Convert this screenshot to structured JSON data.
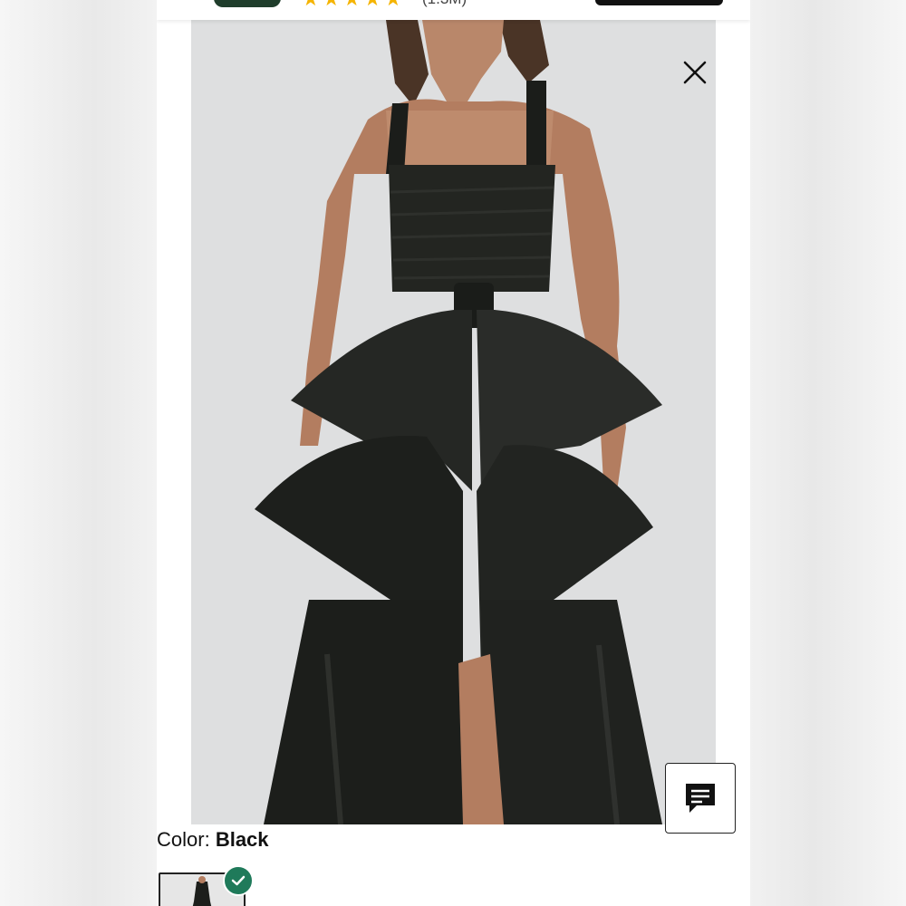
{
  "topbar": {
    "stars": [
      "★",
      "★",
      "★",
      "★",
      "★"
    ],
    "review_count": "(1.3M)"
  },
  "product": {
    "image_alt": "Black dress with oversized bow",
    "color_label": "Color:",
    "color_value": "Black"
  },
  "icons": {
    "close": "close-icon",
    "chat": "chat-icon",
    "check": "check-icon",
    "star": "star-icon"
  },
  "colors": {
    "brand_green": "#1f3d2b",
    "star_gold": "#f5b400",
    "check_green": "#1f7a5a",
    "dress_black": "#1d1f1c",
    "photo_bg": "#dedfe0"
  }
}
